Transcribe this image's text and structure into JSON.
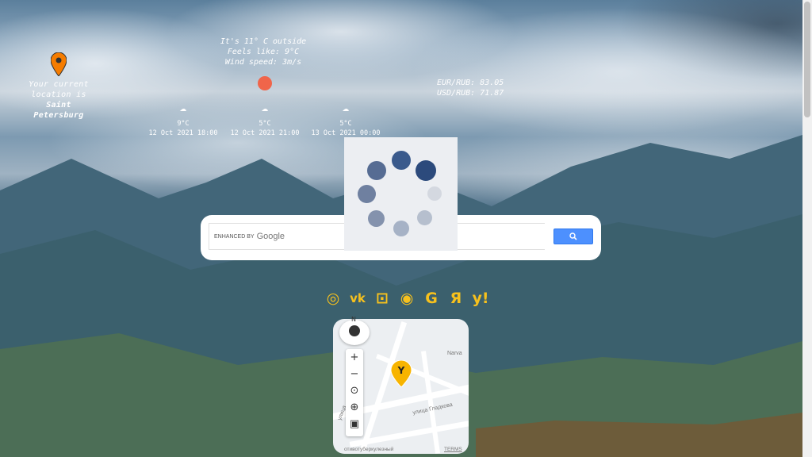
{
  "location": {
    "line1": "Your current",
    "line2": "location is",
    "city_line1": "Saint",
    "city_line2": "Petersburg"
  },
  "weather": {
    "line1": "It's 11° C outside",
    "line2": "Feels like: 9°C",
    "line3": "Wind speed: 3m/s"
  },
  "forecast": [
    {
      "temp": "9°C",
      "time": "12 Oct 2021 18:00",
      "icon": "cloud-icon"
    },
    {
      "temp": "5°C",
      "time": "12 Oct 2021 21:00",
      "icon": "partly-cloudy-icon"
    },
    {
      "temp": "5°C",
      "time": "13 Oct 2021 00:00",
      "icon": "cloud-icon"
    }
  ],
  "rates": {
    "eur": "EUR/RUB: 83.05",
    "usd": "USD/RUB: 71.87"
  },
  "search": {
    "enhanced": "ENHANCED BY",
    "brand": "Google",
    "button_icon": "search-icon"
  },
  "social": [
    "instagram-icon",
    "vk-icon",
    "github-icon",
    "discord-icon",
    "google-icon",
    "yandex-icon",
    "yahoo-icon"
  ],
  "map": {
    "street1": "улица Гладкова",
    "street2": "Narva",
    "street3": "улица",
    "bottom": "отивотуберкулезный",
    "terms": "TERMS",
    "compass_n": "N"
  },
  "colors": {
    "accent": "#f7c11d",
    "sun": "#f0654a",
    "search_button": "#4d90fe"
  }
}
